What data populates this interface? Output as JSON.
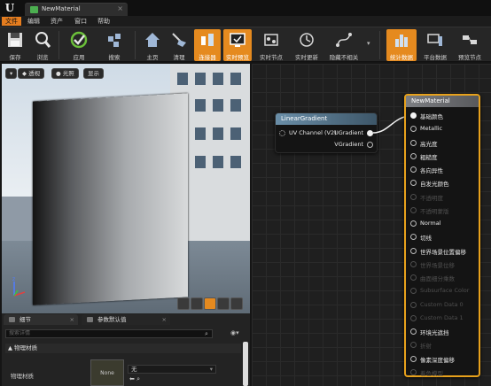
{
  "window": {
    "document_tab": "NewMaterial"
  },
  "menu": [
    "文件",
    "编辑",
    "资产",
    "窗口",
    "帮助"
  ],
  "toolbar": [
    {
      "label": "保存",
      "icon": "save-icon",
      "active": false
    },
    {
      "label": "浏览",
      "icon": "browse-icon",
      "active": false
    },
    {
      "label": "应用",
      "icon": "apply-icon",
      "active": false
    },
    {
      "label": "搜索",
      "icon": "search-icon",
      "active": false
    },
    {
      "label": "主页",
      "icon": "home-icon",
      "active": false
    },
    {
      "label": "清理",
      "icon": "clean-icon",
      "active": false
    },
    {
      "label": "连接器",
      "icon": "connectors-icon",
      "active": true
    },
    {
      "label": "实时预览",
      "icon": "live-preview-icon",
      "active": true
    },
    {
      "label": "实时节点",
      "icon": "live-nodes-icon",
      "active": false
    },
    {
      "label": "实时更新",
      "icon": "live-update-icon",
      "active": false
    },
    {
      "label": "隐藏不相关",
      "icon": "hide-unrelated-icon",
      "active": false
    },
    {
      "label": "统计数据",
      "icon": "stats-icon",
      "active": true
    },
    {
      "label": "平台数据",
      "icon": "platform-stats-icon",
      "active": false
    },
    {
      "label": "预览节点",
      "icon": "preview-nodes-icon",
      "active": false
    }
  ],
  "viewport": {
    "perspective_label": "透视",
    "lit_label": "光照",
    "show_label": "显示"
  },
  "details": {
    "tab_details": "细节",
    "tab_params": "参数默认值",
    "search_placeholder": "搜索详情",
    "category": "▲ 物理材质",
    "row_label": "物理材质",
    "thumb_text": "None",
    "combo_value": "无"
  },
  "linear_gradient_node": {
    "title": "LinearGradient",
    "input": "UV Channel (V2)",
    "outputs": [
      "UGradient",
      "VGradient"
    ]
  },
  "material_node": {
    "title": "NewMaterial",
    "pins": [
      {
        "label": "基础颜色",
        "enabled": true,
        "connected": true
      },
      {
        "label": "Metallic",
        "enabled": true,
        "connected": false
      },
      {
        "label": "高光度",
        "enabled": true,
        "connected": false
      },
      {
        "label": "粗糙度",
        "enabled": true,
        "connected": false
      },
      {
        "label": "各向异性",
        "enabled": true,
        "connected": false
      },
      {
        "label": "自发光颜色",
        "enabled": true,
        "connected": false
      },
      {
        "label": "不透明度",
        "enabled": false,
        "connected": false
      },
      {
        "label": "不透明蒙版",
        "enabled": false,
        "connected": false
      },
      {
        "label": "Normal",
        "enabled": true,
        "connected": false
      },
      {
        "label": "切线",
        "enabled": true,
        "connected": false
      },
      {
        "label": "世界场景位置偏移",
        "enabled": true,
        "connected": false
      },
      {
        "label": "世界场景位移",
        "enabled": false,
        "connected": false
      },
      {
        "label": "曲面细分乘数",
        "enabled": false,
        "connected": false
      },
      {
        "label": "Subsurface Color",
        "enabled": false,
        "connected": false
      },
      {
        "label": "Custom Data 0",
        "enabled": false,
        "connected": false
      },
      {
        "label": "Custom Data 1",
        "enabled": false,
        "connected": false
      },
      {
        "label": "环境光遮挡",
        "enabled": true,
        "connected": false
      },
      {
        "label": "折射",
        "enabled": false,
        "connected": false
      },
      {
        "label": "像素深度偏移",
        "enabled": true,
        "connected": false
      },
      {
        "label": "着色模型",
        "enabled": false,
        "connected": false
      }
    ]
  },
  "colors": {
    "accent": "#e58a1f",
    "node_border": "#e7a11c"
  }
}
